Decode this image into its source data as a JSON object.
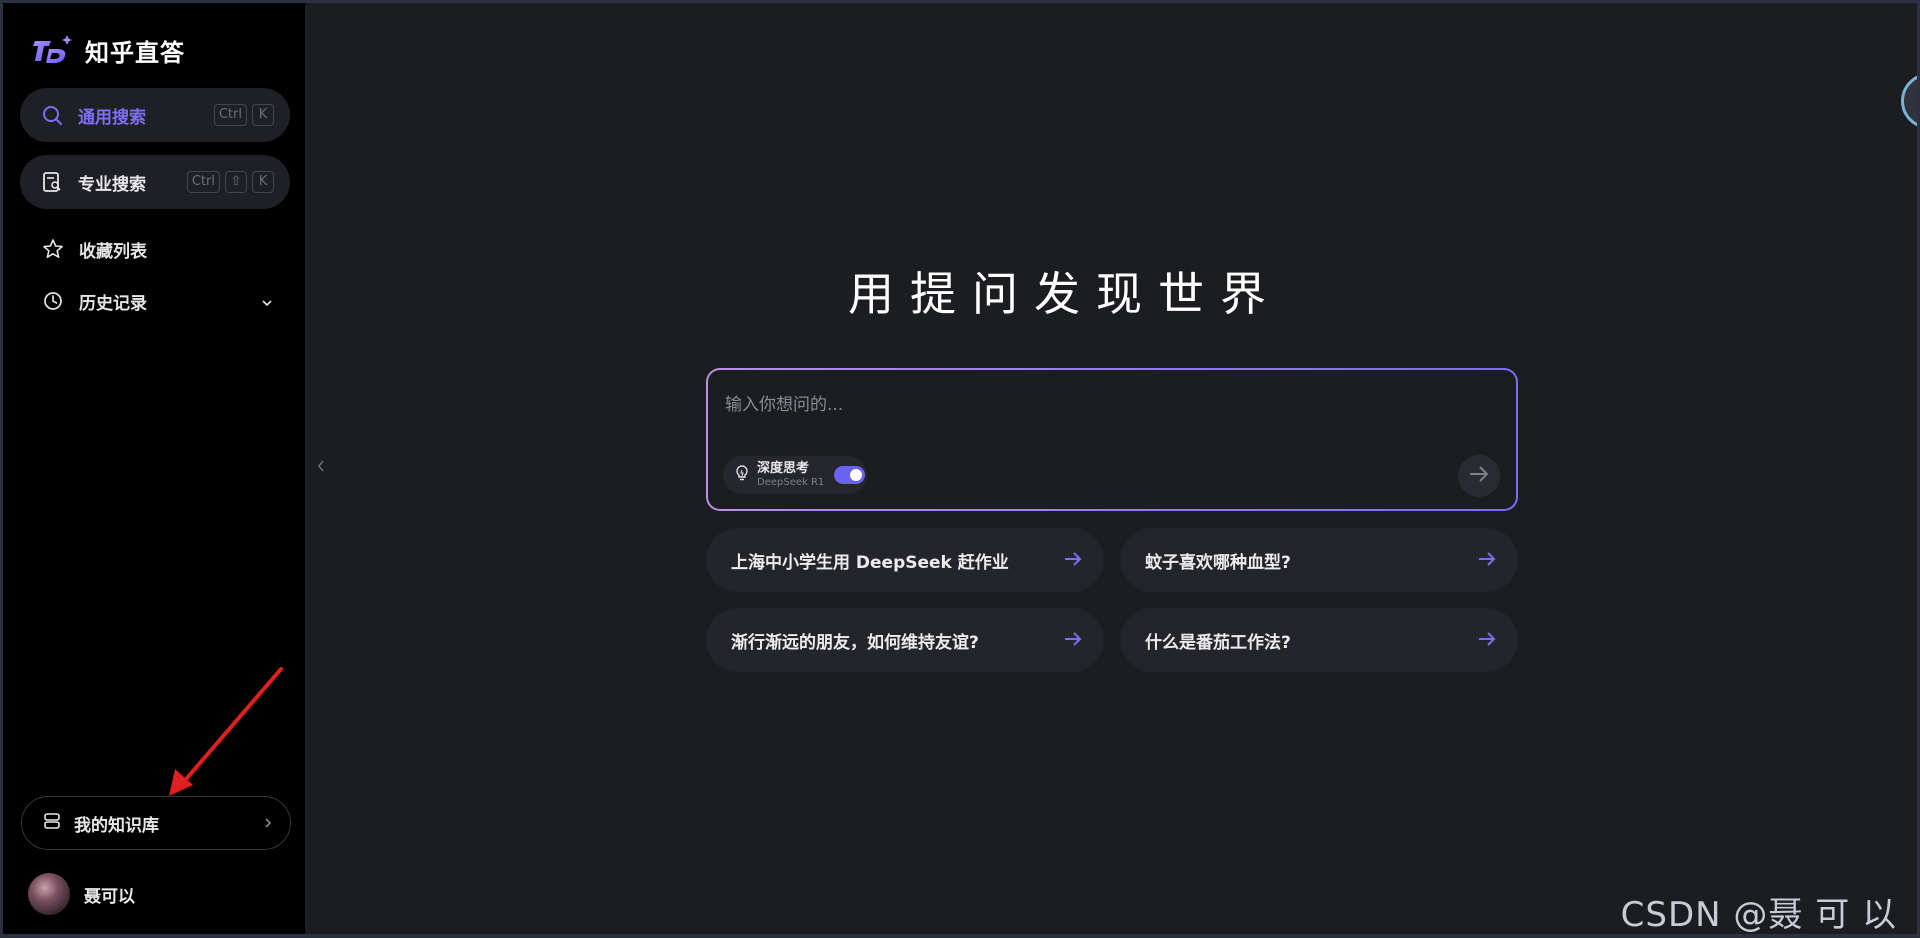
{
  "app": {
    "name": "知乎直答"
  },
  "sidebar": {
    "general_search": {
      "label": "通用搜索",
      "keys": [
        "Ctrl",
        "K"
      ]
    },
    "pro_search": {
      "label": "专业搜索",
      "keys": [
        "Ctrl",
        "⇧",
        "K"
      ]
    },
    "favorites": {
      "label": "收藏列表"
    },
    "history": {
      "label": "历史记录"
    },
    "knowledge_base": {
      "label": "我的知识库"
    },
    "user": {
      "name": "聂可以"
    }
  },
  "main": {
    "heading": "用提问发现世界",
    "input": {
      "placeholder": "输入你想问的..."
    },
    "deep_think": {
      "title": "深度思考",
      "model": "DeepSeek R1",
      "enabled": true
    },
    "suggestions": [
      {
        "label": "上海中小学生用 DeepSeek 赶作业"
      },
      {
        "label": "蚊子喜欢哪种血型?"
      },
      {
        "label": "渐行渐远的朋友，如何维持友谊?"
      },
      {
        "label": "什么是番茄工作法?"
      }
    ]
  },
  "watermark": "CSDN @聂 可 以",
  "colors": {
    "accent": "#6a62f2",
    "sidebar_bg": "#000000",
    "main_bg": "#1c1d21",
    "annotation_arrow": "#e02020"
  }
}
